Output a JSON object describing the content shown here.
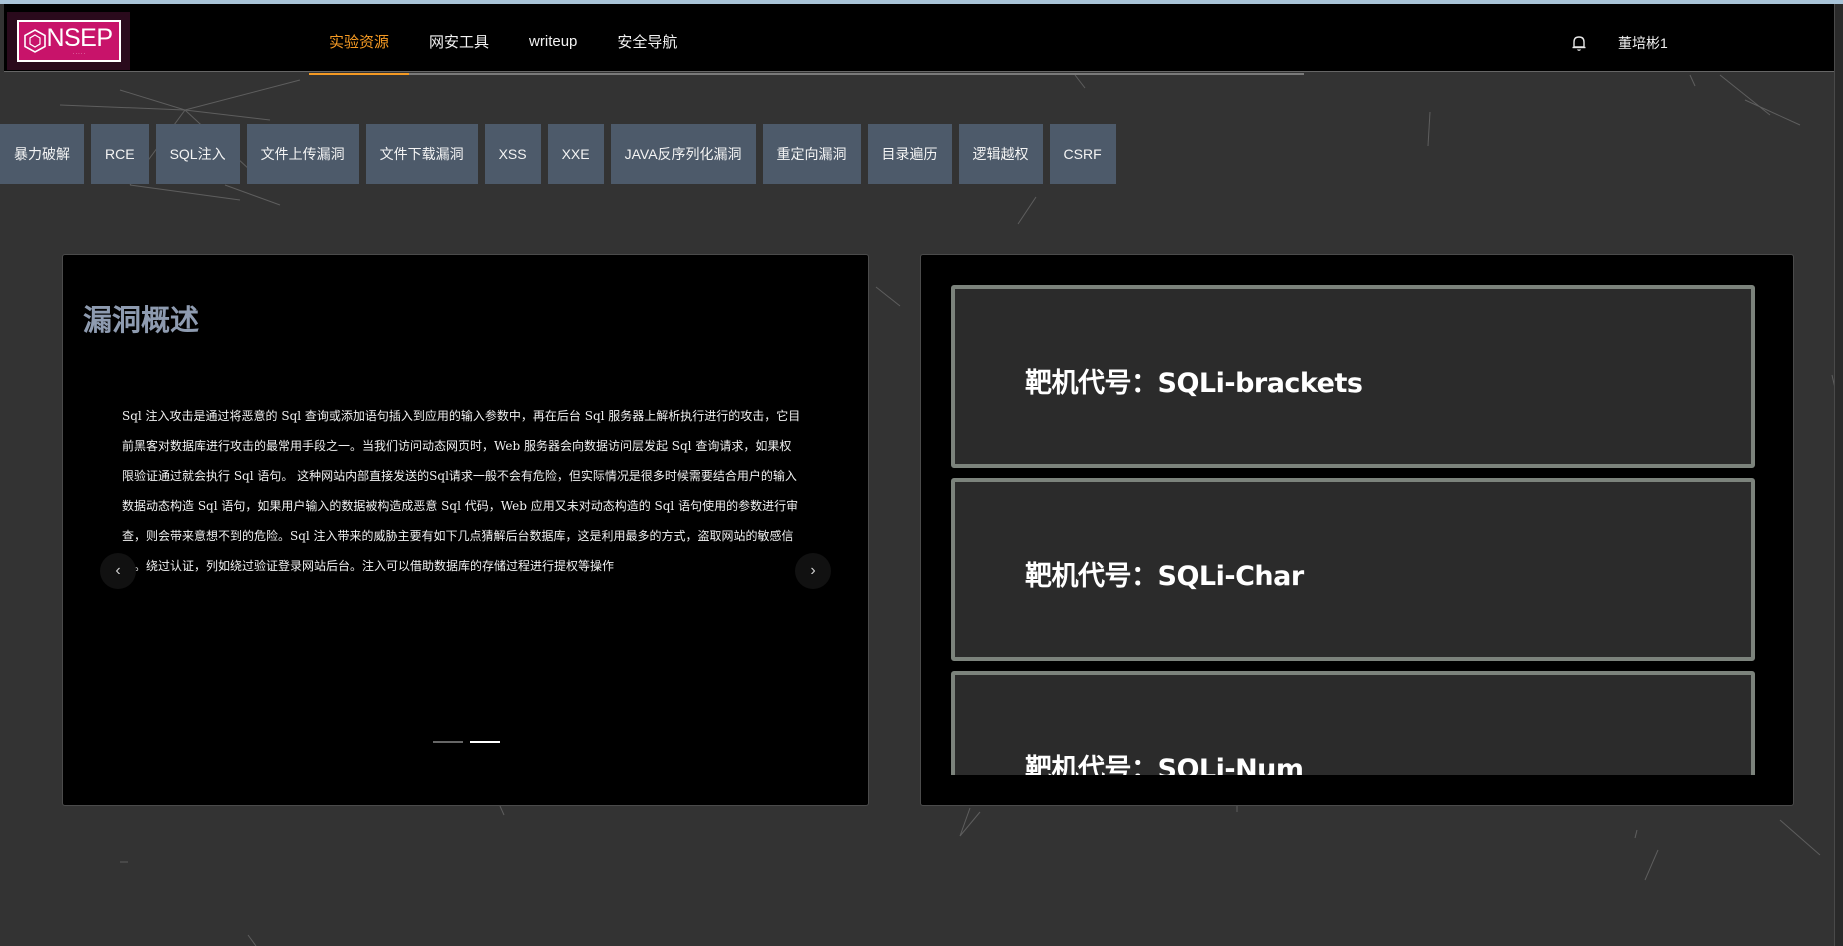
{
  "header": {
    "logo_text": "NSEP",
    "nav": [
      {
        "label": "实验资源",
        "active": true
      },
      {
        "label": "网安工具",
        "active": false
      },
      {
        "label": "writeup",
        "active": false
      },
      {
        "label": "安全导航",
        "active": false
      }
    ],
    "username": "董培彬1",
    "icons": {
      "notification": "bell-icon"
    }
  },
  "categories": [
    "暴力破解",
    "RCE",
    "SQL注入",
    "文件上传漏洞",
    "文件下载漏洞",
    "XSS",
    "XXE",
    "JAVA反序列化漏洞",
    "重定向漏洞",
    "目录遍历",
    "逻辑越权",
    "CSRF"
  ],
  "overview": {
    "title": "漏洞概述",
    "text": "Sql 注入攻击是通过将恶意的 Sql 查询或添加语句插入到应用的输入参数中，再在后台 Sql 服务器上解析执行进行的攻击，它目前黑客对数据库进行攻击的最常用手段之一。当我们访问动态网页时，Web 服务器会向数据访问层发起 Sql 查询请求，如果权限验证通过就会执行 Sql 语句。 这种网站内部直接发送的Sql请求一般不会有危险，但实际情况是很多时候需要结合用户的输入数据动态构造 Sql 语句，如果用户输入的数据被构造成恶意 Sql 代码，Web 应用又未对动态构造的 Sql 语句使用的参数进行审查，则会带来意想不到的危险。Sql 注入带来的威胁主要有如下几点猜解后台数据库，这是利用最多的方式，盗取网站的敏感信息。绕过认证，列如绕过验证登录网站后台。注入可以借助数据库的存储过程进行提权等操作",
    "prev_icon": "chevron-left-icon",
    "next_icon": "chevron-right-icon",
    "slides": 2,
    "active_slide": 2
  },
  "targets": [
    {
      "label": "靶机代号：SQLi-brackets"
    },
    {
      "label": "靶机代号：SQLi-Char"
    },
    {
      "label": "靶机代号：SQLi-Num"
    }
  ],
  "colors": {
    "accent": "#f59a23",
    "tab_bg": "#4d5a6a",
    "page_bg": "#333333",
    "title": "#8e9bb0"
  }
}
